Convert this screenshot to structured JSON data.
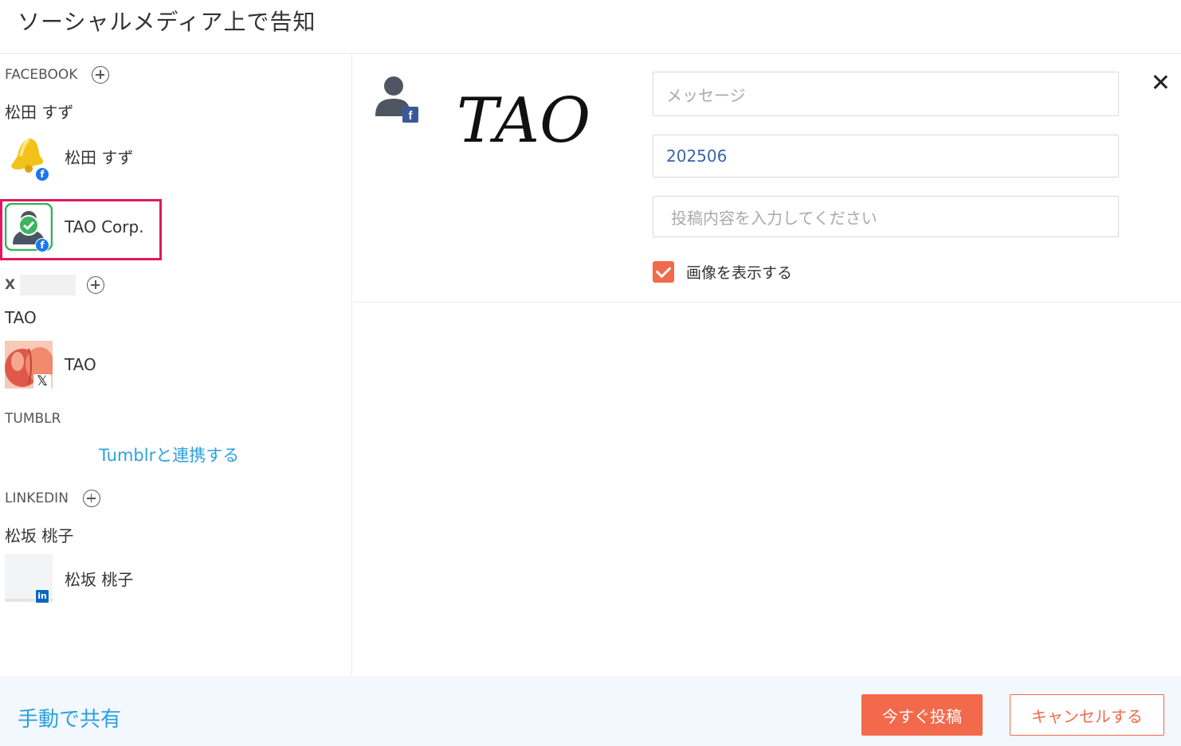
{
  "dialog": {
    "title": "ソーシャルメディア上で告知"
  },
  "sidebar": {
    "facebook": {
      "header": "FACEBOOK",
      "owner": "松田 すず",
      "accounts": [
        {
          "name": "松田 すず",
          "icon": "bell-avatar"
        },
        {
          "name": "TAO Corp.",
          "icon": "user-check-avatar",
          "selected": true
        }
      ]
    },
    "x": {
      "header": "X",
      "owner": "TAO",
      "accounts": [
        {
          "name": "TAO",
          "icon": "peach-avatar"
        }
      ]
    },
    "tumblr": {
      "header": "TUMBLR",
      "link": "Tumblrと連携する"
    },
    "linkedin": {
      "header": "LINKEDIN",
      "owner": "松坂 桃子",
      "accounts": [
        {
          "name": "松坂 桃子",
          "icon": "blank-avatar"
        }
      ]
    }
  },
  "main": {
    "logo_text": "TAO",
    "message_placeholder": "メッセージ",
    "title_value": "202506",
    "content_placeholder": "投稿内容を入力してください",
    "show_image_label": "画像を表示する",
    "show_image_checked": true
  },
  "footer": {
    "manual_share": "手動で共有",
    "post_now": "今すぐ投稿",
    "cancel": "キャンセルする"
  },
  "colors": {
    "accent": "#f26a4b",
    "link": "#2ea0e0",
    "selection": "#e2175f",
    "facebook": "#1877f2",
    "linkedin": "#0a66c2"
  }
}
